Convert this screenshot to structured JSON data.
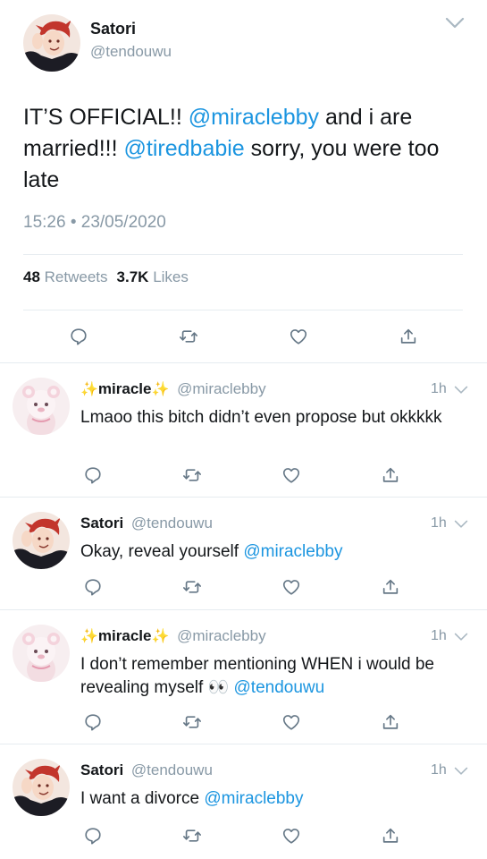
{
  "main_tweet": {
    "author_name": "Satori",
    "author_handle": "@tendouwu",
    "text_part1": "IT’S OFFICIAL!! ",
    "mention1": "@miraclebby",
    "text_part2": " and i are married!!! ",
    "mention2": "@tiredbabie",
    "text_part3": " sorry, you were too late",
    "timestamp": "15:26 • 23/05/2020",
    "retweets_count": "48",
    "retweets_label": "Retweets",
    "likes_count": "3.7K",
    "likes_label": "Likes"
  },
  "replies": [
    {
      "name": "miracle",
      "sparkle": "✨",
      "handle": "@miraclebby",
      "time": "1h",
      "text": "Lmaoo this bitch didn’t even propose but okkkkk"
    },
    {
      "name": "Satori",
      "handle": "@tendouwu",
      "time": "1h",
      "text": "Okay, reveal yourself ",
      "mention": "@miraclebby"
    },
    {
      "name": "miracle",
      "sparkle": "✨",
      "handle": "@miraclebby",
      "time": "1h",
      "text": "I don’t remember mentioning WHEN i would be revealing myself 👀 ",
      "mention": "@tendouwu"
    },
    {
      "name": "Satori",
      "handle": "@tendouwu",
      "time": "1h",
      "text": "I want a divorce ",
      "mention": "@miraclebby"
    }
  ],
  "colors": {
    "link": "#1b95e0",
    "muted": "#8899a6",
    "divider": "#e6ecf0"
  }
}
